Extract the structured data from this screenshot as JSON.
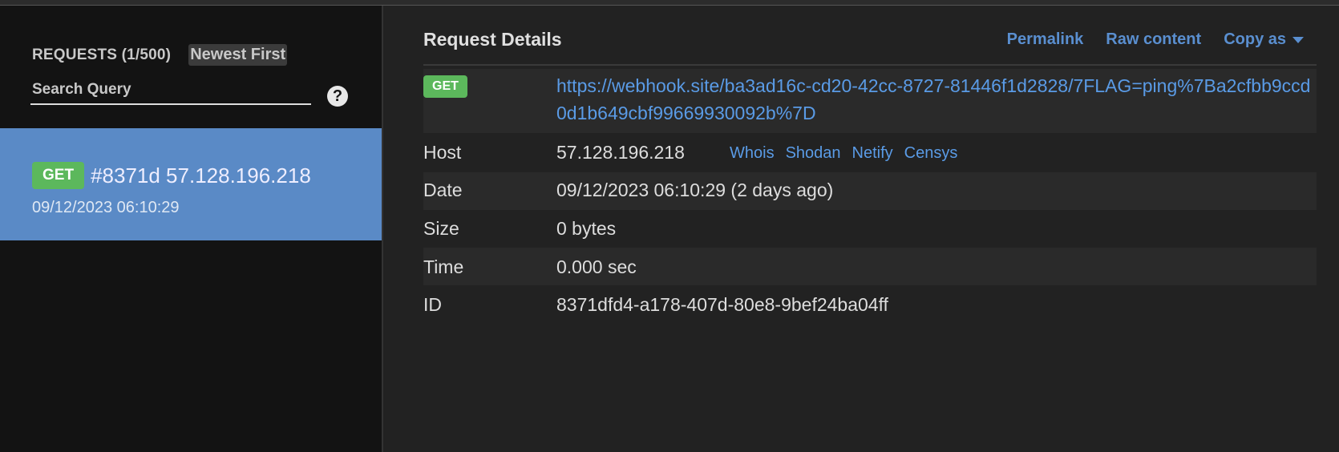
{
  "sidebar": {
    "requests_label": "REQUESTS (1/500)",
    "sort_label": "Newest First",
    "search_placeholder": "Search Query",
    "help_icon": "question-circle-icon",
    "items": [
      {
        "method": "GET",
        "title": "#8371d 57.128.196.218",
        "date": "09/12/2023 06:10:29"
      }
    ]
  },
  "details": {
    "title": "Request Details",
    "links": {
      "permalink": "Permalink",
      "raw": "Raw content",
      "copy_as": "Copy as"
    },
    "method": "GET",
    "url": "https://webhook.site/ba3ad16c-cd20-42cc-8727-81446f1d2828/7FLAG=ping%7Ba2cfbb9ccd0d1b649cbf99669930092b%7D",
    "rows": {
      "host": {
        "label": "Host",
        "value": "57.128.196.218",
        "links": [
          "Whois",
          "Shodan",
          "Netify",
          "Censys"
        ]
      },
      "date": {
        "label": "Date",
        "value": "09/12/2023 06:10:29 (2 days ago)"
      },
      "size": {
        "label": "Size",
        "value": "0 bytes"
      },
      "time": {
        "label": "Time",
        "value": "0.000 sec"
      },
      "id": {
        "label": "ID",
        "value": "8371dfd4-a178-407d-80e8-9bef24ba04ff"
      }
    }
  },
  "colors": {
    "accent": "#5a8ac6",
    "link": "#5a9be6",
    "get_badge": "#5cb85c",
    "sidebar_bg": "#131313",
    "main_bg": "#222222"
  }
}
